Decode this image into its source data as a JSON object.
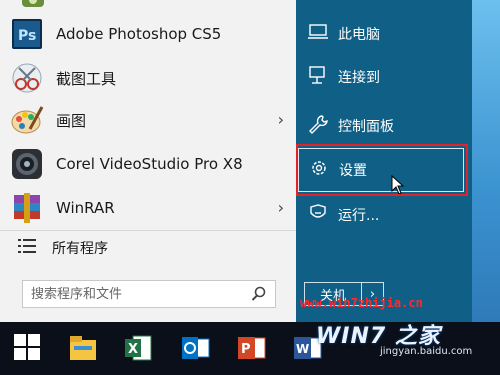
{
  "start_menu": {
    "apps": [
      {
        "label": "Adobe Photoshop CS5",
        "has_submenu": false,
        "icon": "photoshop-icon"
      },
      {
        "label": "截图工具",
        "has_submenu": false,
        "icon": "snipping-tool-icon"
      },
      {
        "label": "画图",
        "has_submenu": true,
        "icon": "paint-icon"
      },
      {
        "label": "Corel VideoStudio Pro X8",
        "has_submenu": false,
        "icon": "videostudio-icon"
      },
      {
        "label": "WinRAR",
        "has_submenu": true,
        "icon": "winrar-icon"
      }
    ],
    "submenu_chevron": "›",
    "all_programs": "所有程序",
    "search_placeholder": "搜索程序和文件"
  },
  "right_pane": {
    "items": [
      {
        "label": "此电脑",
        "icon": "computer-icon"
      },
      {
        "label": "连接到",
        "icon": "connect-icon"
      },
      {
        "label": "控制面板",
        "icon": "control-panel-icon"
      },
      {
        "label": "设置",
        "icon": "settings-gear-icon",
        "highlighted": true
      },
      {
        "label": "运行...",
        "icon": "run-icon"
      }
    ],
    "power_button": "关机",
    "power_arrow": "›"
  },
  "taskbar": {
    "items": [
      "start-button",
      "file-explorer-icon",
      "excel-icon",
      "outlook-icon",
      "powerpoint-icon",
      "word-icon"
    ]
  },
  "watermark": {
    "url": "www.win7zhijia.cn",
    "brand": "WIN7 之家",
    "site": "jingyan.baidu.com"
  },
  "colors": {
    "right_pane": "#0f5f86",
    "highlight_border": "#e0242b",
    "taskbar": "#0a0f19"
  }
}
